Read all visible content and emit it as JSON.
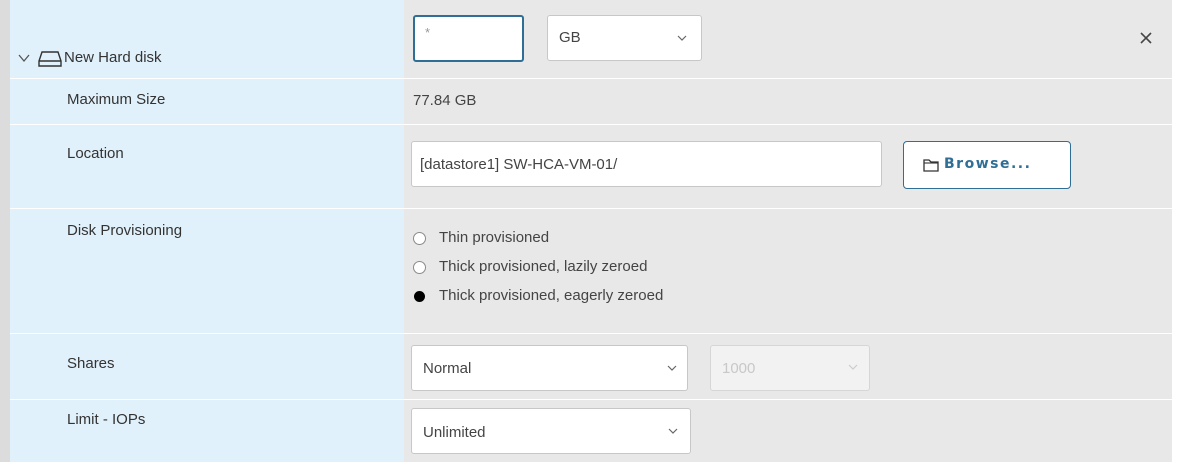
{
  "header": {
    "title": "New Hard disk",
    "size_placeholder": "*",
    "unit_select": "GB"
  },
  "rows": {
    "max_size": {
      "label": "Maximum Size",
      "value": "77.84 GB"
    },
    "location": {
      "label": "Location",
      "value": "[datastore1] SW-HCA-VM-01/",
      "browse_label": "Browse..."
    },
    "disk_provisioning": {
      "label": "Disk Provisioning",
      "options": [
        {
          "label": "Thin provisioned",
          "selected": false
        },
        {
          "label": "Thick provisioned, lazily zeroed",
          "selected": false
        },
        {
          "label": "Thick provisioned, eagerly zeroed",
          "selected": true
        }
      ]
    },
    "shares": {
      "label": "Shares",
      "value": "Normal",
      "count_value": "1000"
    },
    "limit_iops": {
      "label": "Limit - IOPs",
      "value": "Unlimited"
    }
  },
  "icons": {
    "expand": "chevron-down-icon",
    "disk": "hard-disk-icon",
    "close": "close-icon",
    "folder": "folder-icon",
    "dropdown": "chevron-down-icon"
  },
  "colors": {
    "label_bg": "#e1f1fb",
    "value_bg": "#e8e8e8",
    "accent": "#2f6e95"
  }
}
